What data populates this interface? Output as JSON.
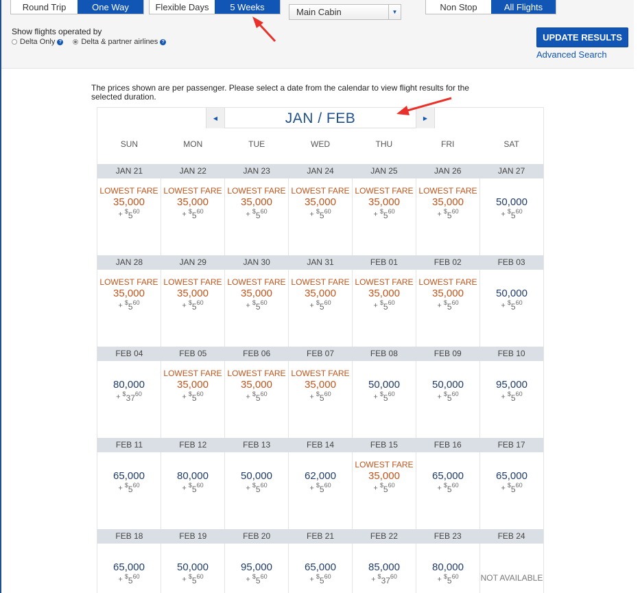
{
  "trip_type": {
    "options": [
      "Round Trip",
      "One Way"
    ],
    "selected": "One Way"
  },
  "date_mode": {
    "options": [
      "Flexible Days",
      "5 Weeks"
    ],
    "selected": "5 Weeks"
  },
  "cabin": {
    "value": "Main Cabin"
  },
  "stops": {
    "options": [
      "Non Stop",
      "All Flights"
    ],
    "selected": "All Flights"
  },
  "operated_by": {
    "label": "Show flights operated by",
    "options": [
      "Delta Only",
      "Delta & partner airlines"
    ],
    "selected": "Delta & partner airlines"
  },
  "update_button": "UPDATE RESULTS",
  "advanced_search": "Advanced Search",
  "note": "The prices shown are per passenger. Please select a date from the calendar to view flight results for the selected duration.",
  "calendar": {
    "month_label": "JAN / FEB",
    "days": [
      "SUN",
      "MON",
      "TUE",
      "WED",
      "THU",
      "FRI",
      "SAT"
    ],
    "lowest_fare_label": "LOWEST FARE",
    "not_available_label": "NOT AVAILABLE",
    "weeks": [
      {
        "dates": [
          "JAN 21",
          "JAN 22",
          "JAN 23",
          "JAN 24",
          "JAN 25",
          "JAN 26",
          "JAN 27"
        ],
        "cells": [
          {
            "low": true,
            "miles": "35,000",
            "fee_d": "5",
            "fee_c": "60"
          },
          {
            "low": true,
            "miles": "35,000",
            "fee_d": "5",
            "fee_c": "60"
          },
          {
            "low": true,
            "miles": "35,000",
            "fee_d": "5",
            "fee_c": "60"
          },
          {
            "low": true,
            "miles": "35,000",
            "fee_d": "5",
            "fee_c": "60"
          },
          {
            "low": true,
            "miles": "35,000",
            "fee_d": "5",
            "fee_c": "60"
          },
          {
            "low": true,
            "miles": "35,000",
            "fee_d": "5",
            "fee_c": "60"
          },
          {
            "low": false,
            "miles": "50,000",
            "fee_d": "5",
            "fee_c": "60"
          }
        ]
      },
      {
        "dates": [
          "JAN 28",
          "JAN 29",
          "JAN 30",
          "JAN 31",
          "FEB 01",
          "FEB 02",
          "FEB 03"
        ],
        "cells": [
          {
            "low": true,
            "miles": "35,000",
            "fee_d": "5",
            "fee_c": "60"
          },
          {
            "low": true,
            "miles": "35,000",
            "fee_d": "5",
            "fee_c": "60"
          },
          {
            "low": true,
            "miles": "35,000",
            "fee_d": "5",
            "fee_c": "60"
          },
          {
            "low": true,
            "miles": "35,000",
            "fee_d": "5",
            "fee_c": "60"
          },
          {
            "low": true,
            "miles": "35,000",
            "fee_d": "5",
            "fee_c": "60"
          },
          {
            "low": true,
            "miles": "35,000",
            "fee_d": "5",
            "fee_c": "60"
          },
          {
            "low": false,
            "miles": "50,000",
            "fee_d": "5",
            "fee_c": "60"
          }
        ]
      },
      {
        "dates": [
          "FEB 04",
          "FEB 05",
          "FEB 06",
          "FEB 07",
          "FEB 08",
          "FEB 09",
          "FEB 10"
        ],
        "cells": [
          {
            "low": false,
            "miles": "80,000",
            "fee_d": "37",
            "fee_c": "60"
          },
          {
            "low": true,
            "miles": "35,000",
            "fee_d": "5",
            "fee_c": "60"
          },
          {
            "low": true,
            "miles": "35,000",
            "fee_d": "5",
            "fee_c": "60"
          },
          {
            "low": true,
            "miles": "35,000",
            "fee_d": "5",
            "fee_c": "60"
          },
          {
            "low": false,
            "miles": "50,000",
            "fee_d": "5",
            "fee_c": "60"
          },
          {
            "low": false,
            "miles": "50,000",
            "fee_d": "5",
            "fee_c": "60"
          },
          {
            "low": false,
            "miles": "95,000",
            "fee_d": "5",
            "fee_c": "60"
          }
        ]
      },
      {
        "dates": [
          "FEB 11",
          "FEB 12",
          "FEB 13",
          "FEB 14",
          "FEB 15",
          "FEB 16",
          "FEB 17"
        ],
        "cells": [
          {
            "low": false,
            "miles": "65,000",
            "fee_d": "5",
            "fee_c": "60"
          },
          {
            "low": false,
            "miles": "80,000",
            "fee_d": "5",
            "fee_c": "60"
          },
          {
            "low": false,
            "miles": "50,000",
            "fee_d": "5",
            "fee_c": "60"
          },
          {
            "low": false,
            "miles": "62,000",
            "fee_d": "5",
            "fee_c": "60"
          },
          {
            "low": true,
            "miles": "35,000",
            "fee_d": "5",
            "fee_c": "60"
          },
          {
            "low": false,
            "miles": "65,000",
            "fee_d": "5",
            "fee_c": "60"
          },
          {
            "low": false,
            "miles": "65,000",
            "fee_d": "5",
            "fee_c": "60"
          }
        ]
      },
      {
        "dates": [
          "FEB 18",
          "FEB 19",
          "FEB 20",
          "FEB 21",
          "FEB 22",
          "FEB 23",
          "FEB 24"
        ],
        "cells": [
          {
            "low": false,
            "miles": "65,000",
            "fee_d": "5",
            "fee_c": "60"
          },
          {
            "low": false,
            "miles": "50,000",
            "fee_d": "5",
            "fee_c": "60"
          },
          {
            "low": false,
            "miles": "95,000",
            "fee_d": "5",
            "fee_c": "60"
          },
          {
            "low": false,
            "miles": "65,000",
            "fee_d": "5",
            "fee_c": "60"
          },
          {
            "low": false,
            "miles": "85,000",
            "fee_d": "37",
            "fee_c": "60"
          },
          {
            "low": false,
            "miles": "80,000",
            "fee_d": "5",
            "fee_c": "60"
          },
          {
            "na": true
          }
        ]
      }
    ]
  },
  "colors": {
    "brand_blue": "#1155b5",
    "lowest_fare": "#c0541b",
    "annotation_arrow": "#e8312b"
  }
}
